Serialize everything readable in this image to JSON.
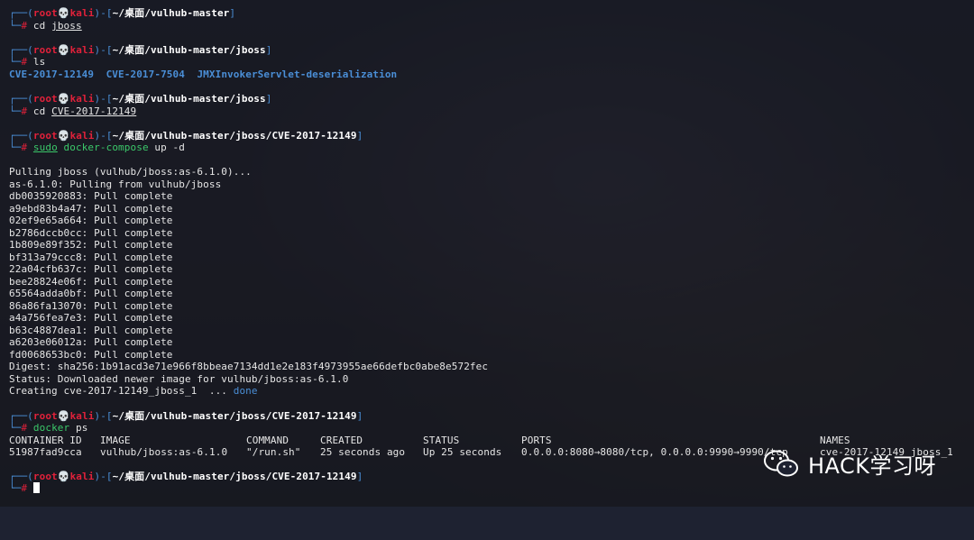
{
  "prompt_user": "root",
  "prompt_skull": "💀",
  "prompt_host": "kali",
  "blocks": [
    {
      "path": "~/桌面/vulhub-master",
      "command": "cd",
      "arg": "jboss"
    },
    {
      "path": "~/桌面/vulhub-master/jboss",
      "command": "ls",
      "arg": ""
    },
    {
      "path": "~/桌面/vulhub-master/jboss",
      "command": "cd",
      "arg": "CVE-2017-12149"
    },
    {
      "path": "~/桌面/vulhub-master/jboss/CVE-2017-12149",
      "command": "sudo",
      "arg": "docker-compose",
      "rest": " up -d"
    },
    {
      "path": "~/桌面/vulhub-master/jboss/CVE-2017-12149",
      "command": "docker",
      "arg": "ps"
    },
    {
      "path": "~/桌面/vulhub-master/jboss/CVE-2017-12149"
    }
  ],
  "ls_output": [
    "CVE-2017-12149",
    "CVE-2017-7504",
    "JMXInvokerServlet-deserialization"
  ],
  "pull_output": [
    "Pulling jboss (vulhub/jboss:as-6.1.0)...",
    "as-6.1.0: Pulling from vulhub/jboss",
    "db0035920883: Pull complete",
    "a9ebd83b4a47: Pull complete",
    "02ef9e65a664: Pull complete",
    "b2786dccb0cc: Pull complete",
    "1b809e89f352: Pull complete",
    "bf313a79ccc8: Pull complete",
    "22a04cfb637c: Pull complete",
    "bee28824e06f: Pull complete",
    "65564adda0bf: Pull complete",
    "86a86fa13070: Pull complete",
    "a4a756fea7e3: Pull complete",
    "b63c4887dea1: Pull complete",
    "a6203e06012a: Pull complete",
    "fd0068653bc0: Pull complete",
    "Digest: sha256:1b91acd3e71e966f8bbeae7134dd1e2e183f4973955ae66defbc0abe8e572fec",
    "Status: Downloaded newer image for vulhub/jboss:as-6.1.0"
  ],
  "creating_line": "Creating cve-2017-12149_jboss_1  ... ",
  "creating_done": "done",
  "ps_table": {
    "headers": [
      "CONTAINER ID",
      "IMAGE",
      "COMMAND",
      "CREATED",
      "STATUS",
      "PORTS",
      "NAMES"
    ],
    "row": [
      "51987fad9cca",
      "vulhub/jboss:as-6.1.0",
      "\"/run.sh\"",
      "25 seconds ago",
      "Up 25 seconds",
      "0.0.0.0:8080→8080/tcp, 0.0.0.0:9990→9990/tcp",
      "cve-2017-12149_jboss_1"
    ]
  },
  "watermark": "HACK学习呀"
}
